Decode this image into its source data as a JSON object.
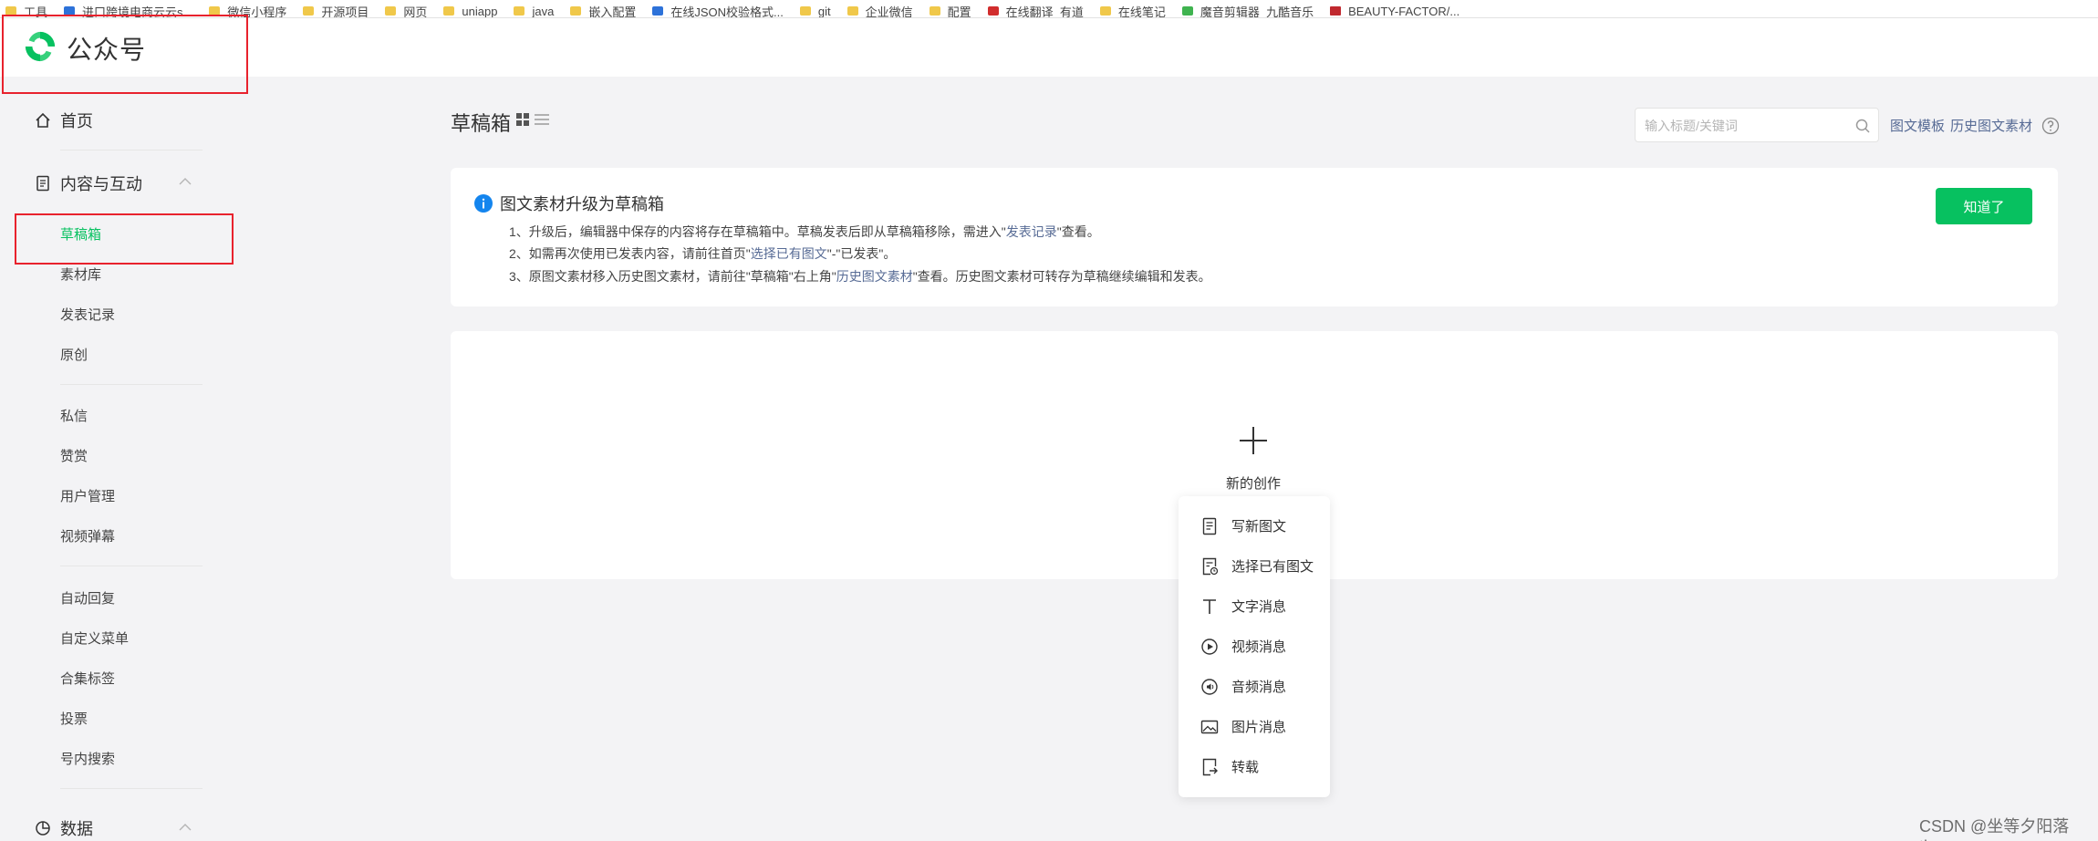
{
  "bookmarks": [
    {
      "label": "工具",
      "icon": "folder-icon"
    },
    {
      "label": "进口跨境电商云云s...",
      "icon": "site-icon"
    },
    {
      "label": "微信小程序",
      "icon": "folder-icon"
    },
    {
      "label": "开源项目",
      "icon": "folder-icon"
    },
    {
      "label": "网页",
      "icon": "folder-icon"
    },
    {
      "label": "uniapp",
      "icon": "folder-icon"
    },
    {
      "label": "java",
      "icon": "folder-icon"
    },
    {
      "label": "嵌入配置",
      "icon": "folder-icon"
    },
    {
      "label": "在线JSON校验格式...",
      "icon": "site-icon"
    },
    {
      "label": "git",
      "icon": "folder-icon"
    },
    {
      "label": "企业微信",
      "icon": "folder-icon"
    },
    {
      "label": "配置",
      "icon": "folder-icon"
    },
    {
      "label": "在线翻译_有道",
      "icon": "youdao-icon"
    },
    {
      "label": "在线笔记",
      "icon": "folder-icon"
    },
    {
      "label": "魔音剪辑器_九酷音乐",
      "icon": "music-icon"
    },
    {
      "label": "BEAUTY-FACTOR/...",
      "icon": "site-icon"
    }
  ],
  "header": {
    "app_name": "公众号",
    "logo_color": "#07c160"
  },
  "sidebar": {
    "home": "首页",
    "content_group": "内容与互动",
    "content_items": [
      "草稿箱",
      "素材库",
      "发表记录",
      "原创"
    ],
    "message_items": [
      "私信",
      "赞赏",
      "用户管理",
      "视频弹幕"
    ],
    "tool_items": [
      "自动回复",
      "自定义菜单",
      "合集标签",
      "投票",
      "号内搜索"
    ],
    "data_group": "数据",
    "active_color": "#07c160"
  },
  "main": {
    "title": "草稿箱",
    "search_placeholder": "输入标题/关键词",
    "link_template": "图文模板",
    "link_history": "历史图文素材"
  },
  "notice": {
    "title": "图文素材升级为草稿箱",
    "line1_a": "1、升级后，编辑器中保存的内容将存在草稿箱中。草稿发表后即从草稿箱移除，需进入\"",
    "line1_link": "发表记录",
    "line1_b": "\"查看。",
    "line2_a": "2、如需再次使用已发表内容，请前往首页\"",
    "line2_link": "选择已有图文",
    "line2_b": "\"-\"已发表\"。",
    "line3_a": "3、原图文素材移入历史图文素材，请前往\"草稿箱\"右上角\"",
    "line3_link": "历史图文素材",
    "line3_b": "\"查看。历史图文素材可转存为草稿继续编辑和发表。",
    "button": "知道了",
    "button_color": "#07c160"
  },
  "create": {
    "label": "新的创作",
    "menu": [
      {
        "label": "写新图文",
        "icon": "document-icon"
      },
      {
        "label": "选择已有图文",
        "icon": "document-clock-icon"
      },
      {
        "label": "文字消息",
        "icon": "text-icon"
      },
      {
        "label": "视频消息",
        "icon": "play-circle-icon"
      },
      {
        "label": "音频消息",
        "icon": "audio-icon"
      },
      {
        "label": "图片消息",
        "icon": "image-icon"
      },
      {
        "label": "转载",
        "icon": "repost-icon"
      }
    ]
  },
  "watermark": "CSDN @坐等夕阳落time"
}
